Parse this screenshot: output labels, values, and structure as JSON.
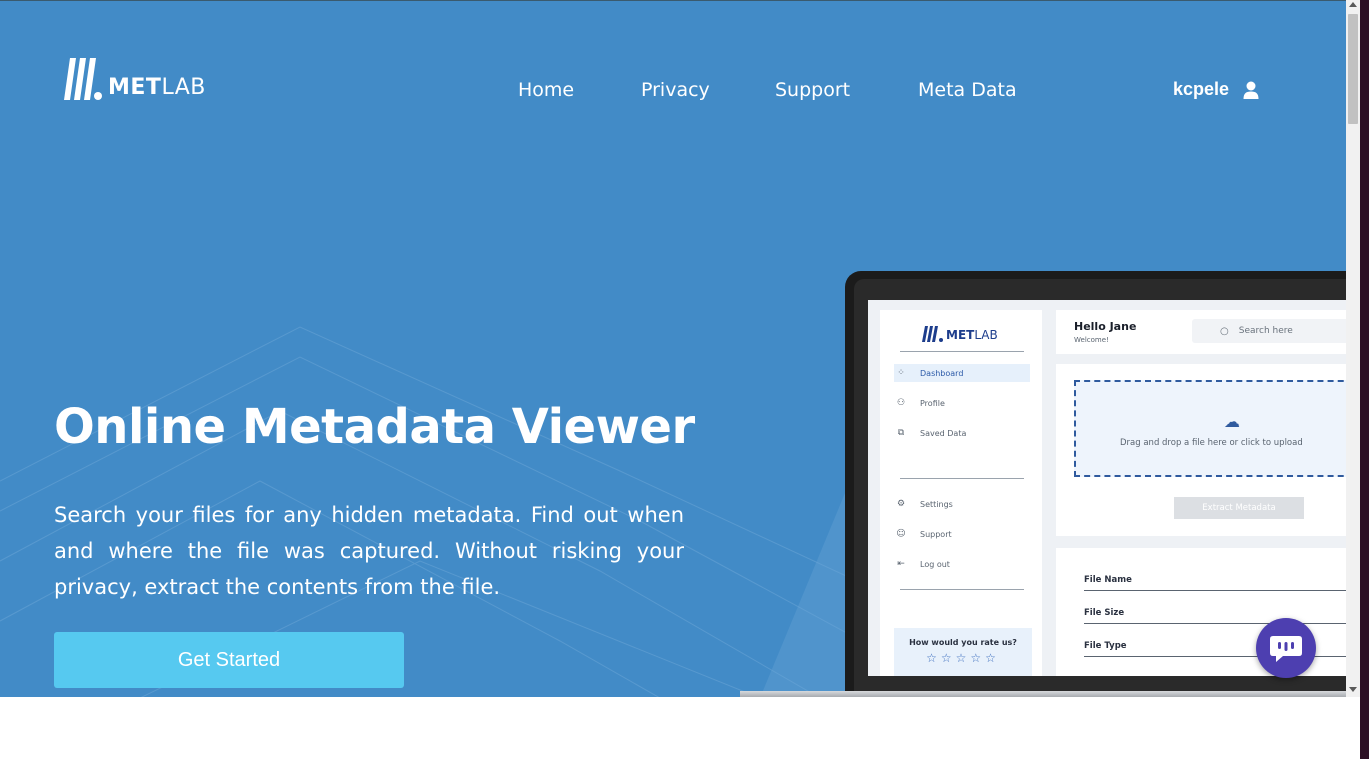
{
  "header": {
    "logo_text_bold": "MET",
    "logo_text_light": "LAB",
    "nav": [
      "Home",
      "Privacy",
      "Support",
      "Meta Data"
    ],
    "username": "kcpele"
  },
  "hero": {
    "title": "Online Metadata Viewer",
    "description": "Search your files for any hidden metadata. Find out when and where the file was captured. Without risking your privacy, extract the contents from the file.",
    "cta_label": "Get Started"
  },
  "mockup": {
    "logo_bold": "MET",
    "logo_light": "LAB",
    "sidebar_items": [
      "Dashboard",
      "Profile",
      "Saved Data"
    ],
    "sidebar_items_bottom": [
      "Settings",
      "Support",
      "Log out"
    ],
    "rate_question": "How would you rate us?",
    "stars": "☆☆☆☆☆",
    "greeting": "Hello Jane",
    "welcome": "Welcome!",
    "search_placeholder": "Search here",
    "drop_text": "Drag and drop a file here or click to upload",
    "extract_label": "Extract Metadata",
    "fields": [
      "File Name",
      "File Size",
      "File Type"
    ]
  },
  "colors": {
    "hero_bg": "#428bc7",
    "cta_bg": "#56c9f0",
    "chat_bg": "#4d3fb0"
  },
  "icons": [
    "user-icon",
    "chat-icon",
    "search-icon",
    "cloud-upload-icon",
    "dashboard-icon",
    "profile-icon",
    "saved-data-icon",
    "settings-icon",
    "support-icon",
    "logout-icon"
  ]
}
